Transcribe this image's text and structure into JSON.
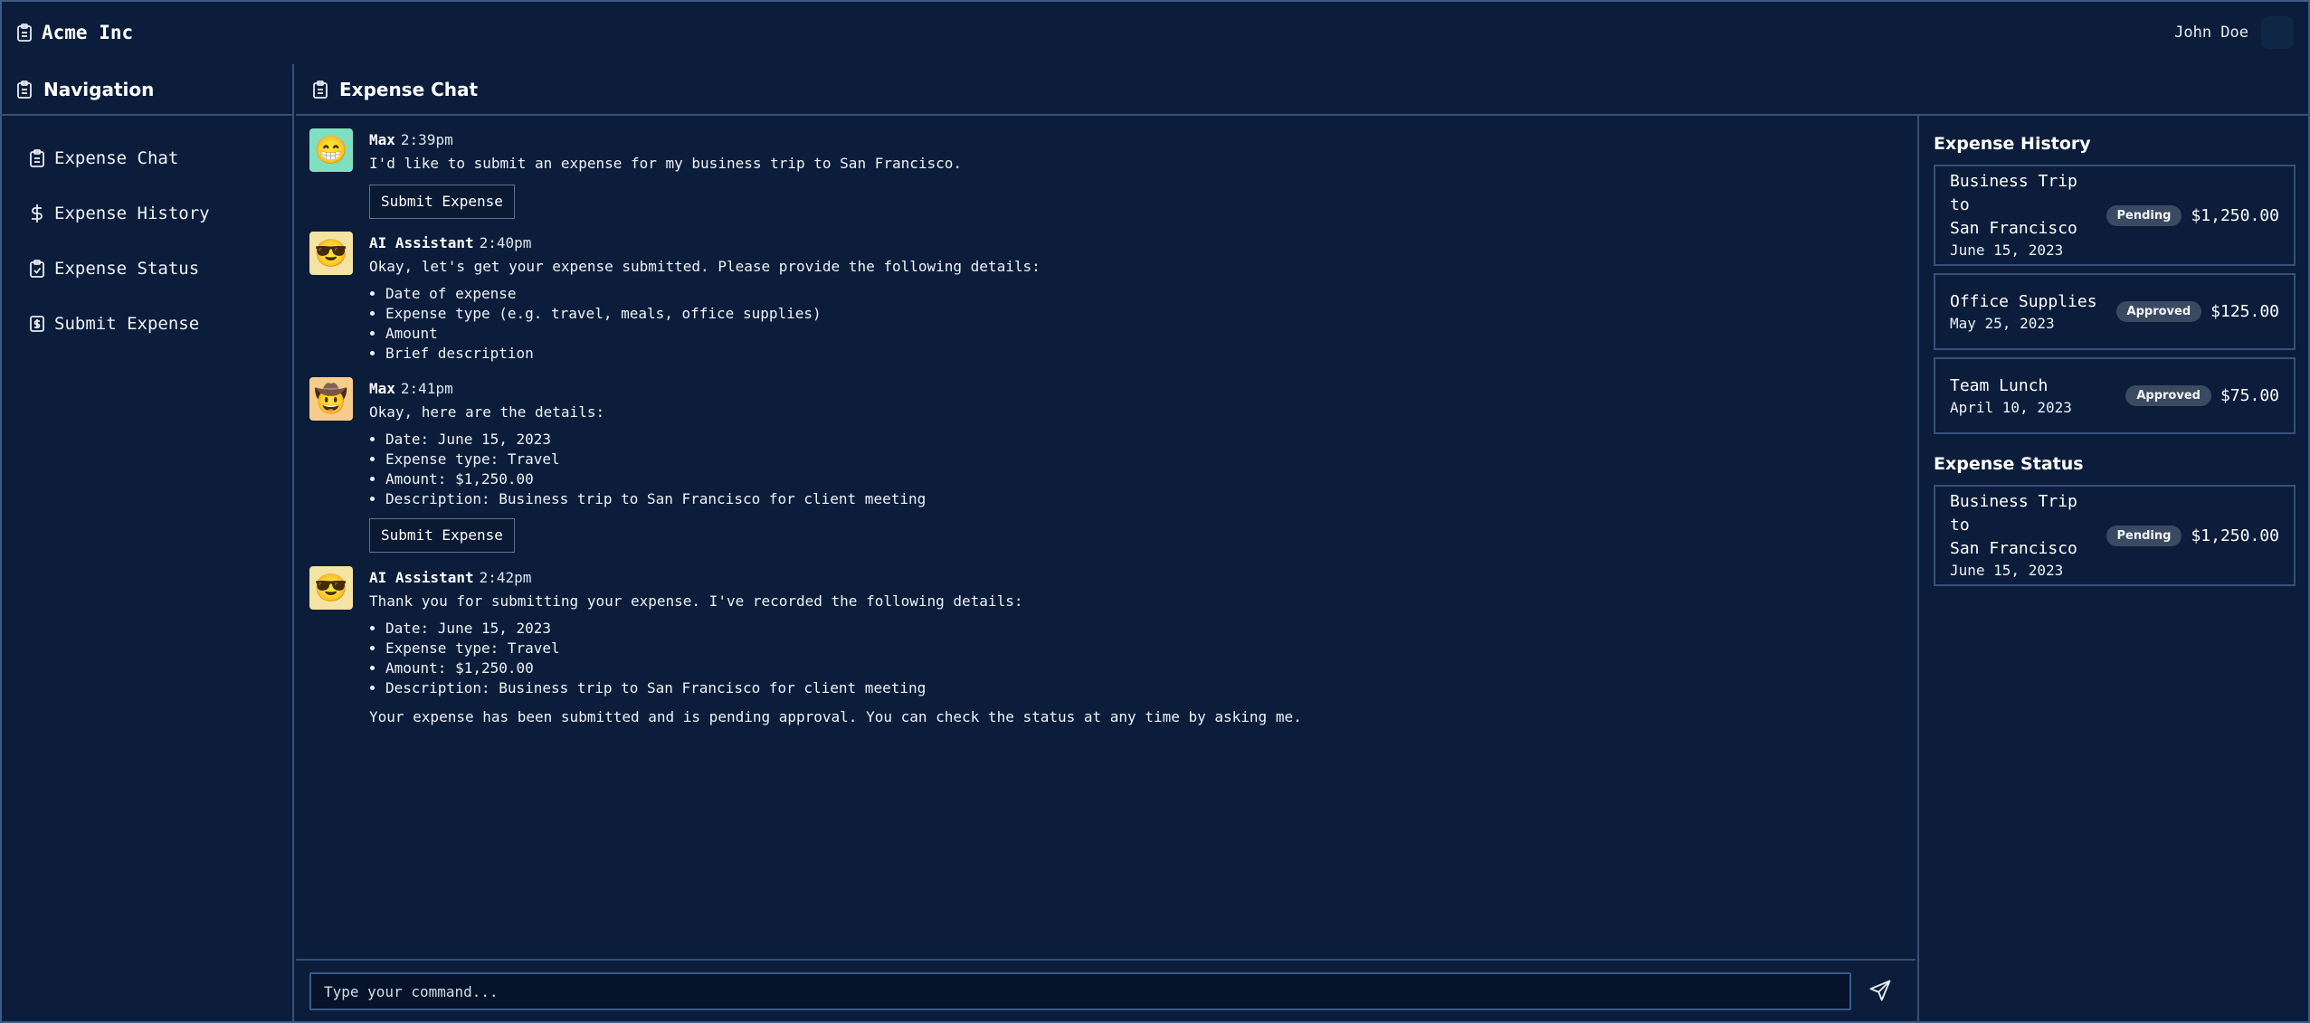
{
  "app": {
    "name": "Acme Inc"
  },
  "user": {
    "name": "John Doe"
  },
  "sidebar": {
    "title": "Navigation",
    "items": [
      {
        "label": "Expense Chat",
        "icon": "clipboard-icon"
      },
      {
        "label": "Expense History",
        "icon": "dollar-icon"
      },
      {
        "label": "Expense Status",
        "icon": "clipboard-check-icon"
      },
      {
        "label": "Submit Expense",
        "icon": "receipt-icon"
      }
    ]
  },
  "main": {
    "title": "Expense Chat"
  },
  "chat": {
    "messages": [
      {
        "author": "Max",
        "time": "2:39pm",
        "avatar": "grinning-face-emoji",
        "avatar_bg": "#7fe0c0",
        "text": "I'd like to submit an expense for my business trip to San Francisco.",
        "button": "Submit Expense"
      },
      {
        "author": "AI Assistant",
        "time": "2:40pm",
        "avatar": "sunglasses-face-emoji",
        "avatar_bg": "#f5e3a3",
        "text": "Okay, let's get your expense submitted. Please provide the following details:",
        "list": [
          "Date of expense",
          "Expense type (e.g. travel, meals, office supplies)",
          "Amount",
          "Brief description"
        ]
      },
      {
        "author": "Max",
        "time": "2:41pm",
        "avatar": "cowboy-face-emoji",
        "avatar_bg": "#f5cc8a",
        "text": "Okay, here are the details:",
        "list": [
          "Date: June 15, 2023",
          "Expense type: Travel",
          "Amount: $1,250.00",
          "Description: Business trip to San Francisco for client meeting"
        ],
        "button": "Submit Expense"
      },
      {
        "author": "AI Assistant",
        "time": "2:42pm",
        "avatar": "sunglasses-face-emoji",
        "avatar_bg": "#f5e3a3",
        "text": "Thank you for submitting your expense. I've recorded the following details:",
        "list": [
          "Date: June 15, 2023",
          "Expense type: Travel",
          "Amount: $1,250.00",
          "Description: Business trip to San Francisco for client meeting"
        ],
        "after": "Your expense has been submitted and is pending approval. You can check the status at any time by asking me."
      }
    ]
  },
  "input": {
    "placeholder": "Type your command..."
  },
  "history": {
    "title": "Expense History",
    "items": [
      {
        "title_line1": "Business Trip to",
        "title_line2": "San Francisco",
        "date": "June 15, 2023",
        "status": "Pending",
        "amount": "$1,250.00"
      },
      {
        "title_line1": "Office Supplies",
        "title_line2": "",
        "date": "May 25, 2023",
        "status": "Approved",
        "amount": "$125.00"
      },
      {
        "title_line1": "Team Lunch",
        "title_line2": "",
        "date": "April 10, 2023",
        "status": "Approved",
        "amount": "$75.00"
      }
    ]
  },
  "status": {
    "title": "Expense Status",
    "items": [
      {
        "title_line1": "Business Trip to",
        "title_line2": "San Francisco",
        "date": "June 15, 2023",
        "status": "Pending",
        "amount": "$1,250.00"
      }
    ]
  },
  "colors": {
    "background": "#0b1d3a",
    "border": "#34507a",
    "badge": "#3a4a61"
  }
}
